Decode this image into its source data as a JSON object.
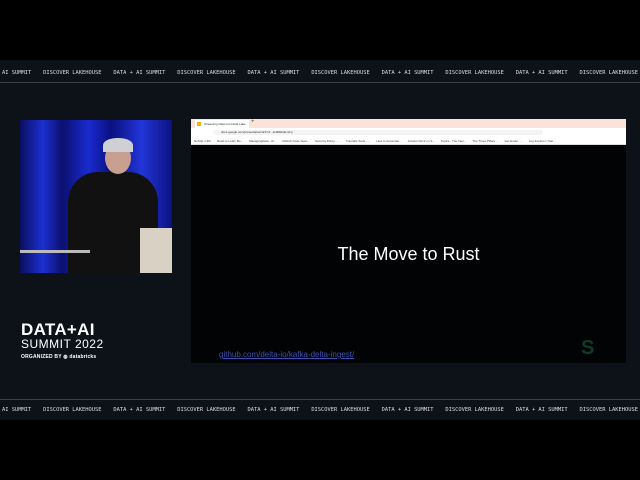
{
  "banner": {
    "items": [
      "AI SUMMIT",
      "DISCOVER LAKEHOUSE",
      "DATA + AI SUMMIT",
      "DISCOVER LAKEHOUSE",
      "DATA + AI SUMMIT",
      "DISCOVER LAKEHOUSE",
      "DATA + AI SUMMIT",
      "DISCOVER LAKEHOUSE",
      "DATA + AI SUMMIT",
      "DISCOVER LAKEHOUSE"
    ]
  },
  "logo": {
    "line1": "DATA+AI",
    "line2": "SUMMIT 2022",
    "line3": "ORGANIZED BY ◍ databricks"
  },
  "browser": {
    "tab_title": "Streaming Data into Delta Lake",
    "new_tab": "+",
    "url": "docs.google.com/presentation/d/1Yxl.../edit#slide=id.p",
    "bookmarks": [
      "NoSQL CDC",
      "Read to Learn Bo...",
      "ManagingData - Ai...",
      "GitHub Code Sear...",
      "Security Policy - ...",
      "Tutorials Tools - ...",
      "How to Automate...",
      "Amazon EC2 on S...",
      "Topics - The Inter...",
      "The Three Pillars ...",
      "Get Email - ...",
      "Log Explorer | Dat..."
    ]
  },
  "slide": {
    "title": "The Move to Rust",
    "link": "github.com/delta-io/kafka-delta-ingest/",
    "mark": "S"
  }
}
